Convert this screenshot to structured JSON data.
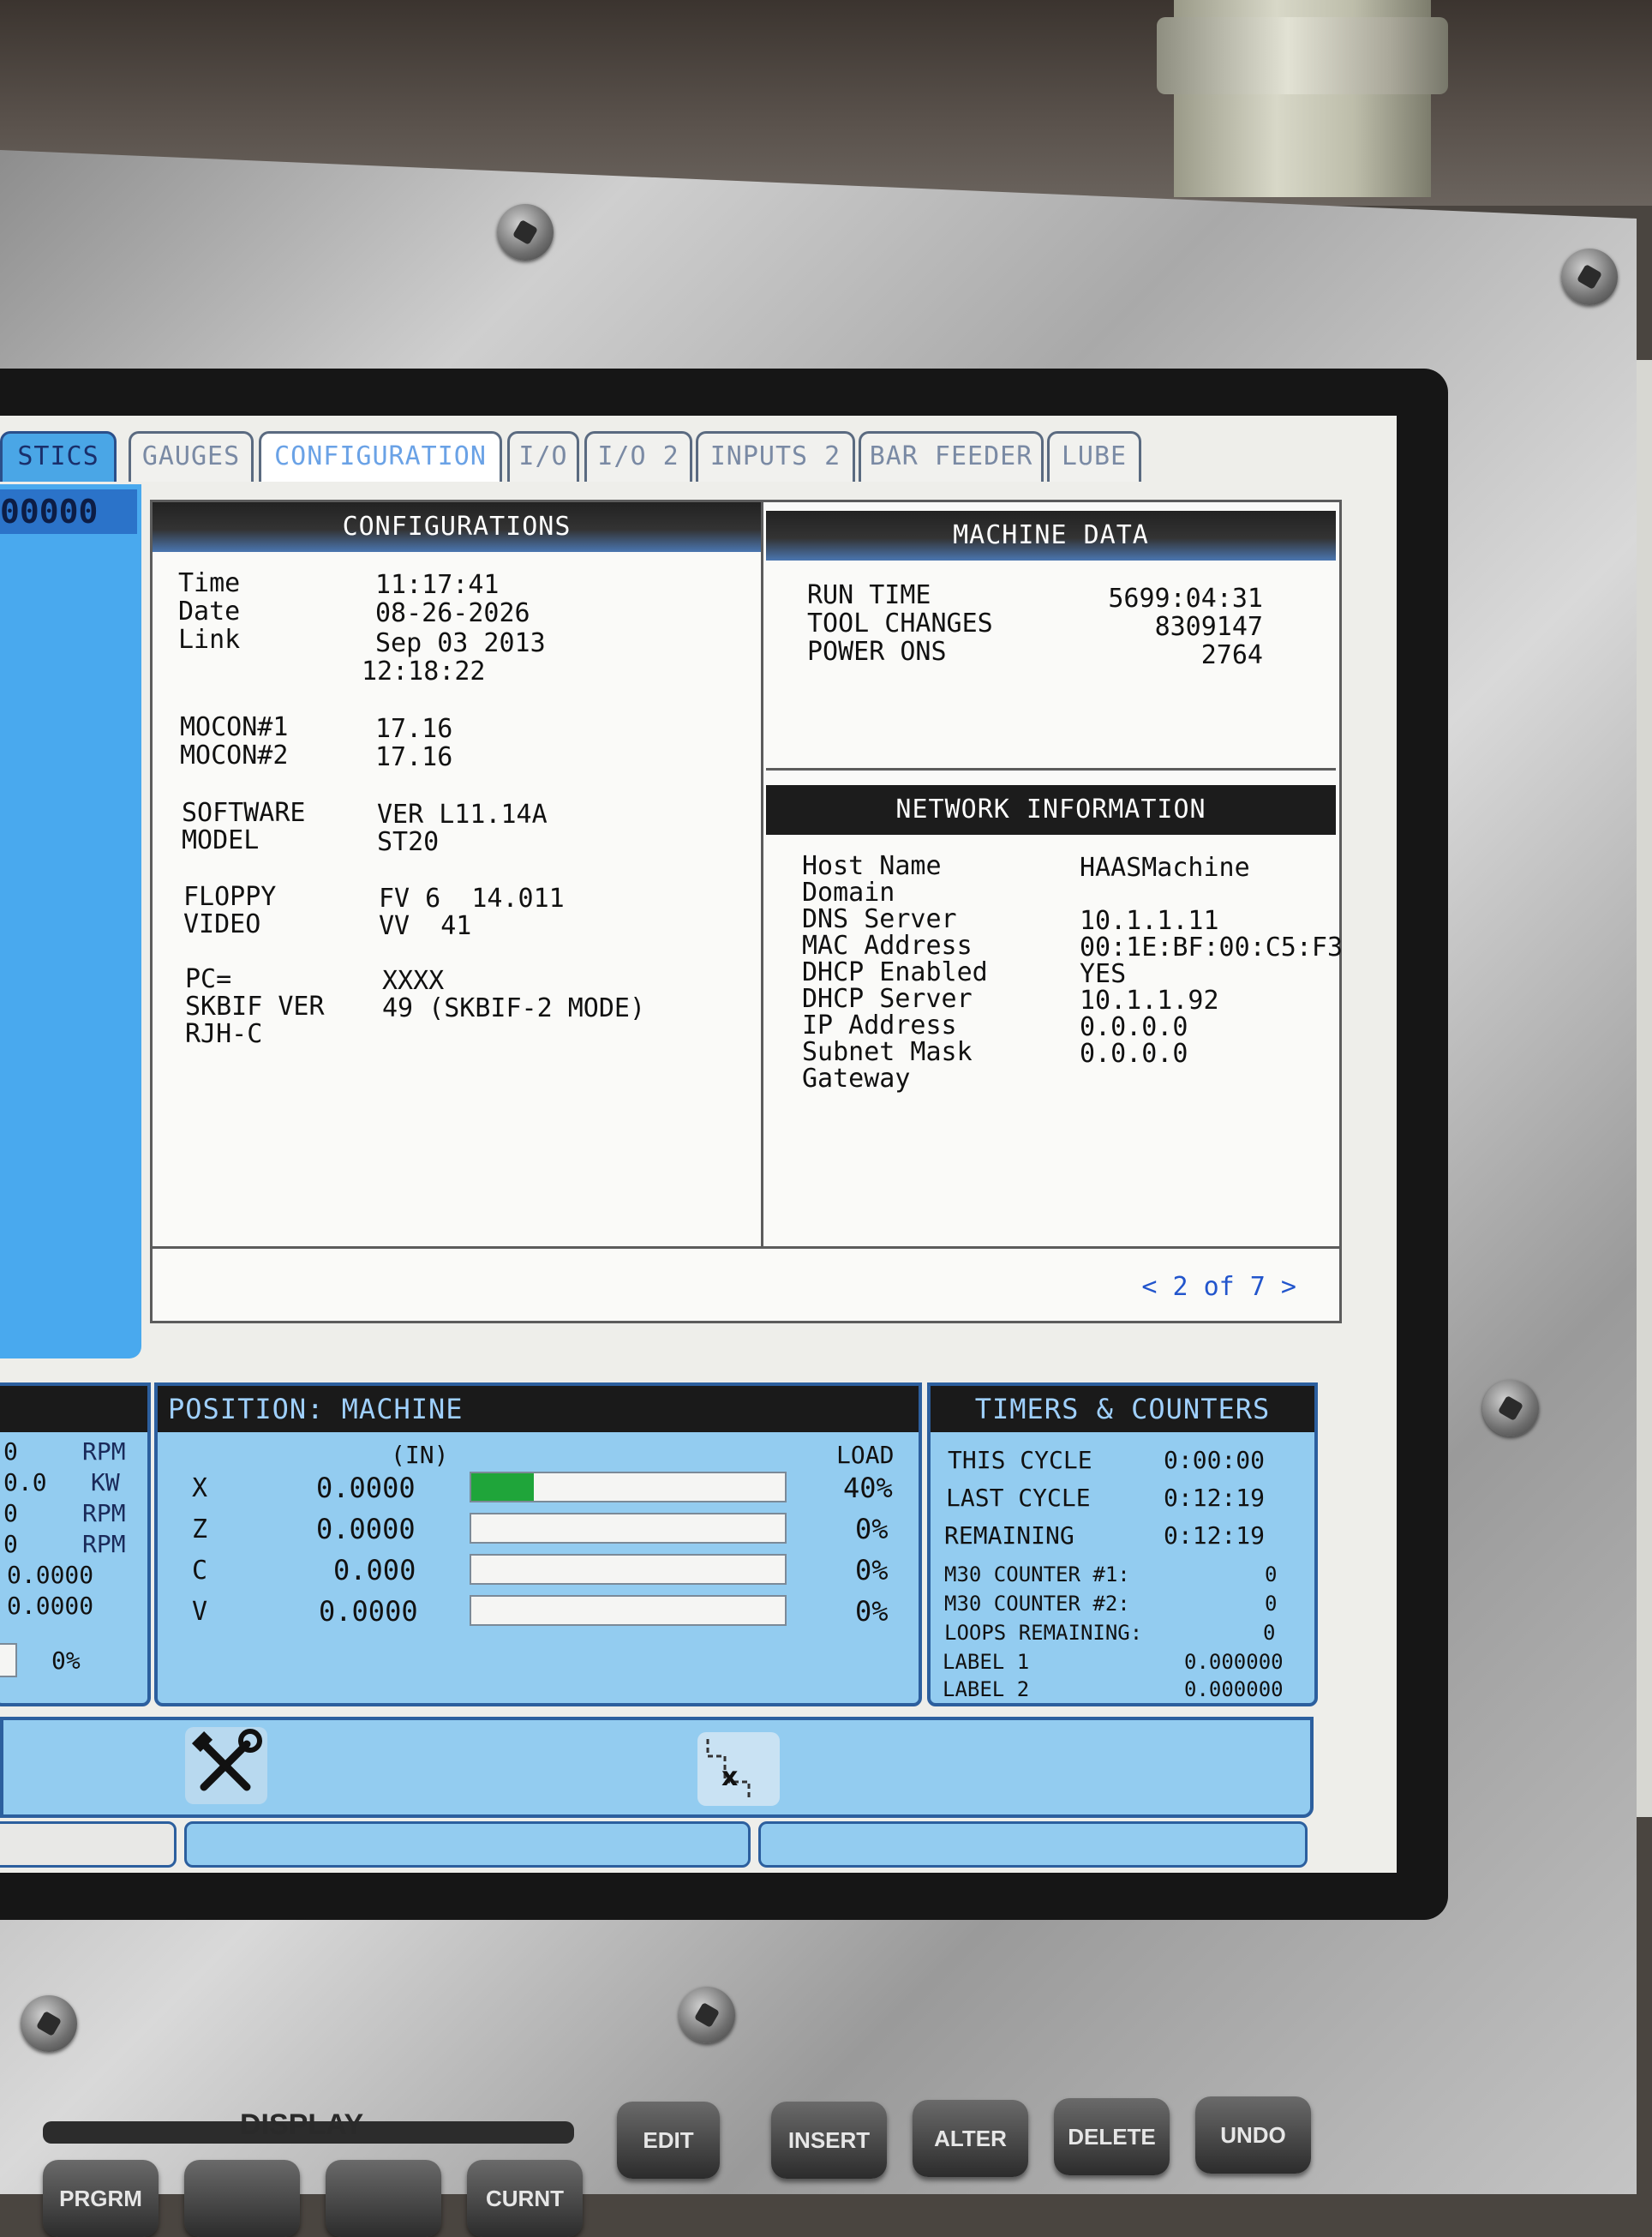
{
  "tabs": [
    "STICS",
    "GAUGES",
    "CONFIGURATION",
    "I/O",
    "I/O 2",
    "INPUTS 2",
    "BAR FEEDER",
    "LUBE"
  ],
  "active_tab": "CONFIGURATION",
  "left_id": "00000",
  "configurations": {
    "title": "CONFIGURATIONS",
    "rows": [
      {
        "k": "Time",
        "v": "11:17:41"
      },
      {
        "k": "Date",
        "v": "08-26-2026"
      },
      {
        "k": "Link",
        "v": "Sep 03 2013"
      },
      {
        "k": "",
        "v": "12:18:22"
      },
      {
        "k": "MOCON#1",
        "v": "17.16"
      },
      {
        "k": "MOCON#2",
        "v": "17.16"
      },
      {
        "k": "SOFTWARE",
        "v": "VER L11.14A"
      },
      {
        "k": "MODEL",
        "v": "ST20"
      },
      {
        "k": "FLOPPY",
        "v": "FV 6  14.011"
      },
      {
        "k": "VIDEO",
        "v": "VV  41"
      },
      {
        "k": "PC=",
        "v": "XXXX"
      },
      {
        "k": "SKBIF VER",
        "v": "49 (SKBIF-2 MODE)"
      },
      {
        "k": "RJH-C",
        "v": ""
      }
    ]
  },
  "machine_data": {
    "title": "MACHINE DATA",
    "rows": [
      {
        "k": "RUN TIME",
        "v": "5699:04:31"
      },
      {
        "k": "TOOL CHANGES",
        "v": "8309147"
      },
      {
        "k": "POWER ONS",
        "v": "2764"
      }
    ]
  },
  "network": {
    "title": "NETWORK INFORMATION",
    "rows": [
      {
        "k": "Host Name",
        "v": "HAASMachine"
      },
      {
        "k": "Domain",
        "v": ""
      },
      {
        "k": "DNS Server",
        "v": "10.1.1.11"
      },
      {
        "k": "MAC Address",
        "v": "00:1E:BF:00:C5:F3"
      },
      {
        "k": "DHCP Enabled",
        "v": "YES"
      },
      {
        "k": "DHCP Server",
        "v": "10.1.1.92"
      },
      {
        "k": "IP Address",
        "v": "0.0.0.0"
      },
      {
        "k": "Subnet Mask",
        "v": "0.0.0.0"
      },
      {
        "k": "Gateway",
        "v": ""
      }
    ]
  },
  "pager": "< 2 of 7 >",
  "spindle": {
    "rows": [
      {
        "v": "0",
        "u": "RPM"
      },
      {
        "v": "0.0",
        "u": "KW"
      },
      {
        "v": "0",
        "u": "RPM"
      },
      {
        "v": "0",
        "u": "RPM"
      },
      {
        "v": "0.0000",
        "u": ""
      },
      {
        "v": "0.0000",
        "u": ""
      }
    ],
    "load": "0%"
  },
  "position": {
    "title": "POSITION: MACHINE",
    "unit": "(IN)",
    "load_label": "LOAD",
    "axes": [
      {
        "axis": "X",
        "value": "0.0000",
        "load": "40%",
        "load_fraction": 0.2
      },
      {
        "axis": "Z",
        "value": "0.0000",
        "load": "0%",
        "load_fraction": 0
      },
      {
        "axis": "C",
        "value": "0.000",
        "load": "0%",
        "load_fraction": 0
      },
      {
        "axis": "V",
        "value": "0.0000",
        "load": "0%",
        "load_fraction": 0
      }
    ]
  },
  "timers": {
    "title": "TIMERS & COUNTERS",
    "times": [
      {
        "k": "THIS CYCLE",
        "v": "0:00:00"
      },
      {
        "k": "LAST CYCLE",
        "v": "0:12:19"
      },
      {
        "k": "REMAINING",
        "v": "0:12:19"
      }
    ],
    "counters": [
      {
        "k": "M30 COUNTER #1:",
        "v": "0"
      },
      {
        "k": "M30 COUNTER #2:",
        "v": "0"
      },
      {
        "k": "LOOPS REMAINING:",
        "v": "0"
      },
      {
        "k": "LABEL 1",
        "v": "0.000000"
      },
      {
        "k": "LABEL 2",
        "v": "0.000000"
      }
    ]
  },
  "icons": [
    "tools-icon",
    "tool-offset-icon"
  ],
  "keyboard": {
    "section_label": "DISPLAY",
    "keys": [
      "EDIT",
      "INSERT",
      "ALTER",
      "DELETE",
      "UNDO"
    ],
    "bottom_keys": [
      "PRGRM",
      "",
      "",
      "CURNT"
    ]
  },
  "colors": {
    "screen_blue": "#93ccf0",
    "panel_border": "#2c5f9e",
    "load_green": "#1fa53a",
    "pager_blue": "#2255cc"
  }
}
